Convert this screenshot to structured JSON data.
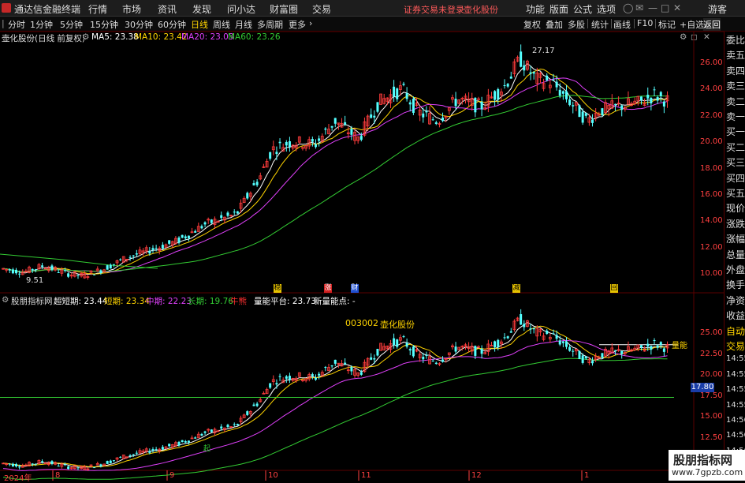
{
  "app": {
    "name": "通达信金融终端",
    "warning": "证券交易未登录",
    "stock_tag": "壶化股份"
  },
  "menu": [
    "行情",
    "市场",
    "资讯",
    "发现",
    "问小达",
    "财富圈",
    "交易"
  ],
  "top_right": [
    "功能",
    "版面",
    "公式",
    "选项"
  ],
  "guest": "游客",
  "periods": [
    "分时",
    "1分钟",
    "5分钟",
    "15分钟",
    "30分钟",
    "60分钟",
    "日线",
    "周线",
    "月线",
    "多周期",
    "更多"
  ],
  "active_period": "日线",
  "right_tools": [
    "复权",
    "叠加",
    "多股",
    "统计",
    "画线",
    "F10",
    "标记",
    "+自选",
    "返回"
  ],
  "main_chart": {
    "title": "壶化股份(日线 前复权)",
    "ma": [
      {
        "label": "MA5: 23.38",
        "color": "#ffffff"
      },
      {
        "label": "MA10: 23.42",
        "color": "#ffd400"
      },
      {
        "label": "MA20: 23.03",
        "color": "#e040fb"
      },
      {
        "label": "MA60: 23.26",
        "color": "#33cc33"
      }
    ],
    "y_ticks": [
      "26.00",
      "24.00",
      "22.00",
      "20.00",
      "18.00",
      "16.00",
      "14.00",
      "12.00",
      "10.00"
    ],
    "high_label": "27.17",
    "low_label": "9.51",
    "markers": [
      "稳",
      "涨",
      "财",
      "减",
      "回"
    ]
  },
  "sub_chart": {
    "title": "股朋指标网",
    "items": [
      {
        "label": "超短期: 23.44",
        "color": "#ffffff"
      },
      {
        "label": "短期: 23.34",
        "color": "#ffd400"
      },
      {
        "label": "中期: 22.23",
        "color": "#e040fb"
      },
      {
        "label": "长期: 19.76",
        "color": "#33cc33"
      },
      {
        "label": "牛熊",
        "color": "#ff3030"
      },
      {
        "label": "量能平台: 23.73",
        "color": "#ffffff"
      },
      {
        "label": "新量能点: -",
        "color": "#ffffff"
      }
    ],
    "code": "003002",
    "name": "壶化股份",
    "y_ticks": [
      "25.00",
      "22.50",
      "20.00",
      "17.50",
      "15.00",
      "12.50"
    ],
    "level_label": "17.80",
    "volume_label": "量能",
    "start_label": "起"
  },
  "x_axis": [
    "2024年",
    "8",
    "9",
    "10",
    "11",
    "12",
    "1"
  ],
  "sidebar": [
    "委比",
    "卖五",
    "卖四",
    "卖三",
    "卖二",
    "卖一",
    "买一",
    "买二",
    "买三",
    "买四",
    "买五",
    "现价",
    "涨跌",
    "涨幅",
    "总量",
    "外盘",
    "换手",
    "净资",
    "收益",
    "自动",
    "交易",
    "14:55",
    "14:55",
    "14:55",
    "14:55",
    "14:56",
    "14:56",
    "14:56",
    "14:56"
  ],
  "watermark": {
    "title": "股朋指标网",
    "url": "www.7gpzb.com"
  },
  "chart_data": {
    "type": "candlestick",
    "dates": [
      "2024-07",
      "2024-08",
      "2024-09",
      "2024-10",
      "2024-11",
      "2024-12",
      "2025-01"
    ],
    "close_approx": [
      10.2,
      10.0,
      10.4,
      19.5,
      22.5,
      24.5,
      23.4
    ],
    "range": [
      9.51,
      27.17
    ]
  }
}
